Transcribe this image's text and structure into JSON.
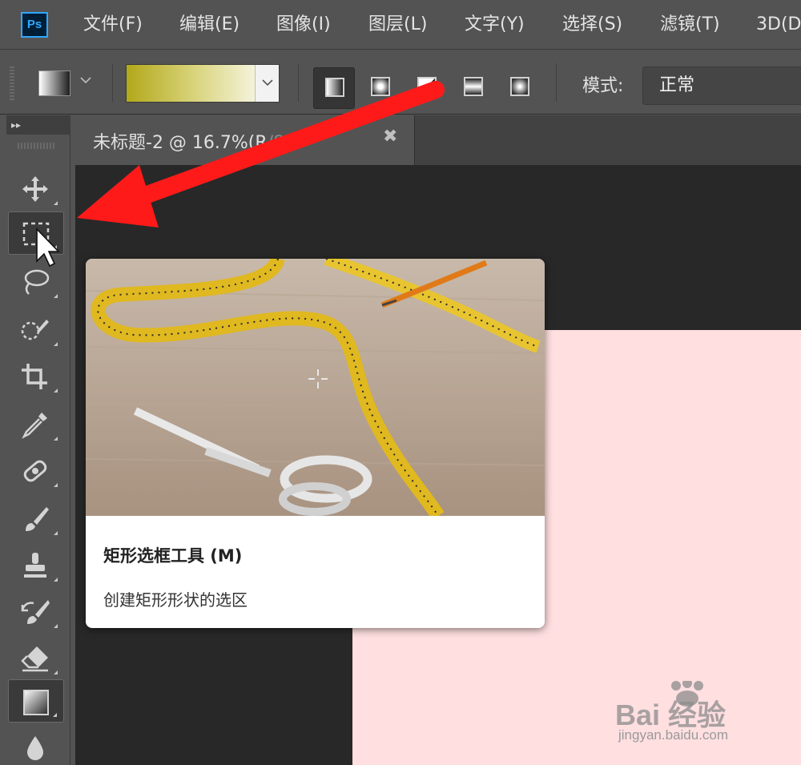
{
  "app": {
    "logo": "Ps"
  },
  "menu": [
    {
      "label": "文件(F)"
    },
    {
      "label": "编辑(E)"
    },
    {
      "label": "图像(I)"
    },
    {
      "label": "图层(L)"
    },
    {
      "label": "文字(Y)"
    },
    {
      "label": "选择(S)"
    },
    {
      "label": "滤镜(T)"
    },
    {
      "label": "3D(D"
    }
  ],
  "options": {
    "gradient_colors": [
      "#b2a81a",
      "#ffffff"
    ],
    "mode_label": "模式:",
    "mode_value": "正常"
  },
  "document_tab": {
    "title": "未标题-2 @ 16.7%(R",
    "title_obscured": "/8)",
    "modified_marker": "*",
    "close_glyph": "✖"
  },
  "toolbar": {
    "collapse_glyph": "▸▸",
    "tools": [
      {
        "name": "move-tool",
        "icon": "move-icon"
      },
      {
        "name": "rectangular-marquee-tool",
        "icon": "rectangular-marquee-icon",
        "active": true
      },
      {
        "name": "lasso-tool",
        "icon": "lasso-icon"
      },
      {
        "name": "quick-selection-tool",
        "icon": "quick-selection-icon"
      },
      {
        "name": "crop-tool",
        "icon": "crop-icon"
      },
      {
        "name": "eyedropper-tool",
        "icon": "eyedropper-icon"
      },
      {
        "name": "healing-brush-tool",
        "icon": "bandage-icon"
      },
      {
        "name": "brush-tool",
        "icon": "brush-icon"
      },
      {
        "name": "clone-stamp-tool",
        "icon": "stamp-icon"
      },
      {
        "name": "history-brush-tool",
        "icon": "history-brush-icon"
      },
      {
        "name": "eraser-tool",
        "icon": "eraser-icon"
      },
      {
        "name": "gradient-tool",
        "icon": "gradient-icon"
      },
      {
        "name": "blur-tool",
        "icon": "blur-drop-icon"
      }
    ]
  },
  "tooltip": {
    "title": "矩形选框工具 (M)",
    "description": "创建矩形形状的选区"
  },
  "canvas": {
    "color": "#ffdfe0"
  },
  "annotation": {
    "color": "#ff1a1a"
  },
  "watermark": {
    "text": "Bai 经验",
    "url": "jingyan.baidu.com"
  }
}
